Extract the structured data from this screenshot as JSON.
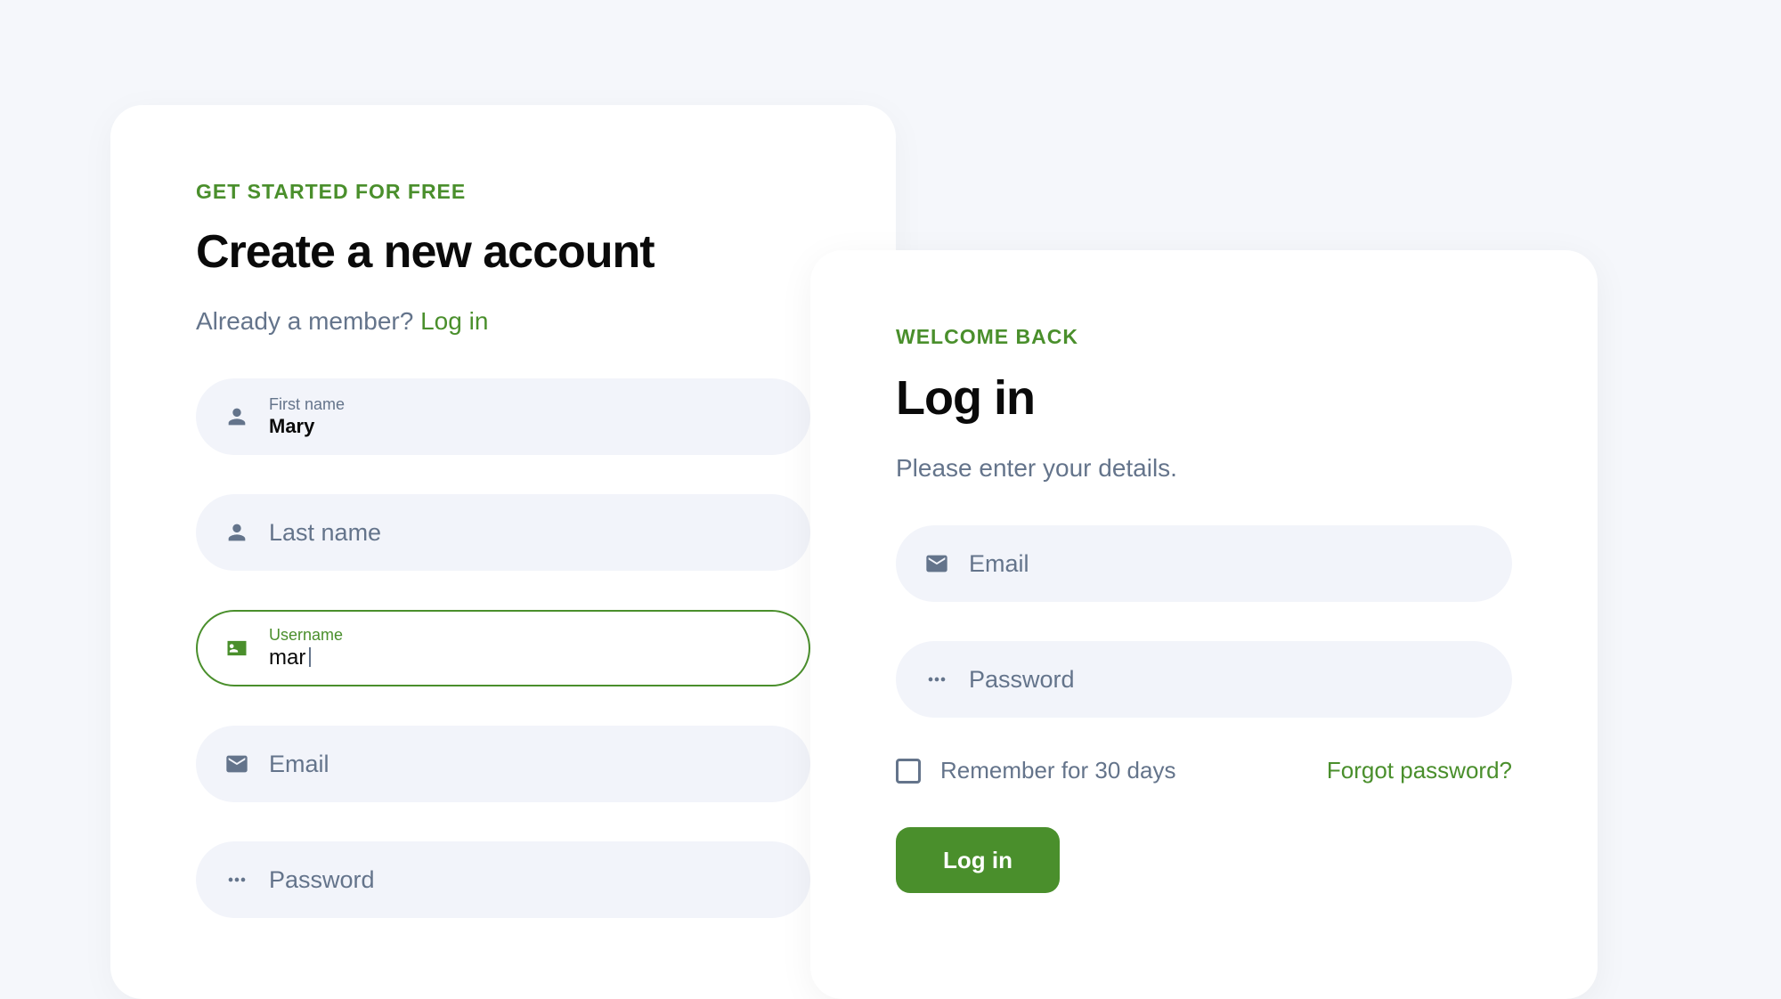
{
  "signup": {
    "eyebrow": "GET STARTED FOR FREE",
    "title": "Create a new account",
    "subtext": "Already a member? ",
    "login_link": "Log in",
    "fields": {
      "firstname": {
        "label": "First name",
        "value": "Mary"
      },
      "lastname": {
        "label": "Last name"
      },
      "username": {
        "label": "Username",
        "value": "mar"
      },
      "email": {
        "label": "Email"
      },
      "password": {
        "label": "Password"
      }
    }
  },
  "login": {
    "eyebrow": "WELCOME BACK",
    "title": "Log in",
    "subtext": "Please enter your details.",
    "fields": {
      "email": {
        "label": "Email"
      },
      "password": {
        "label": "Password"
      }
    },
    "remember_label": "Remember for 30 days",
    "forgot_label": "Forgot password?",
    "button": "Log in"
  }
}
